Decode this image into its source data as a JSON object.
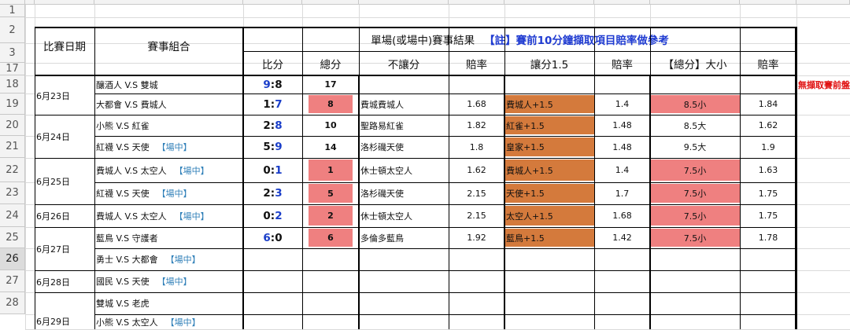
{
  "columns": [
    "A",
    "B",
    "C",
    "D",
    "E",
    "F",
    "G",
    "H",
    "I",
    "J",
    "K",
    "L"
  ],
  "row_numbers": [
    "1",
    "2",
    "3",
    "17",
    "18",
    "19",
    "20",
    "21",
    "22",
    "23",
    "24",
    "25",
    "26",
    "27",
    "28"
  ],
  "header": {
    "date": "比賽日期",
    "match": "賽事組合",
    "result_title": "單場(或場中)賽事結果",
    "note": "【註】賽前10分鐘擷取項目賠率做參考",
    "score": "比分",
    "total": "總分",
    "no_handicap": "不讓分",
    "odds1": "賠率",
    "handicap": "讓分1.5",
    "odds2": "賠率",
    "over_under": "【總分】大小",
    "odds3": "賠率"
  },
  "side_note": "無擷取賽前盤",
  "dates": [
    "6月23日",
    "6月24日",
    "6月25日",
    "6月26日",
    "6月27日",
    "6月28日",
    "6月29日"
  ],
  "rows": [
    {
      "match": "釀酒人 V.S 雙城",
      "tag": "",
      "home": "9",
      "away": "8",
      "total": "17",
      "no_handicap": "",
      "odds1": "",
      "handicap": "",
      "odds2": "",
      "ou": "",
      "odds3": ""
    },
    {
      "match": "大都會 V.S 費城人",
      "tag": "",
      "home": "1",
      "away": "7",
      "total": "8",
      "no_handicap": "費城費城人",
      "odds1": "1.68",
      "handicap": "費城人+1.5",
      "odds2": "1.4",
      "ou": "8.5小",
      "odds3": "1.84"
    },
    {
      "match": "小熊 V.S 紅雀",
      "tag": "",
      "home": "2",
      "away": "8",
      "total": "10",
      "no_handicap": "聖路易紅雀",
      "odds1": "1.82",
      "handicap": "紅雀+1.5",
      "odds2": "1.48",
      "ou": "8.5大",
      "odds3": "1.62"
    },
    {
      "match": "紅襪 V.S 天使",
      "tag": "【場中】",
      "home": "5",
      "away": "9",
      "total": "14",
      "no_handicap": "洛杉磯天使",
      "odds1": "1.8",
      "handicap": "皇家+1.5",
      "odds2": "1.48",
      "ou": "9.5大",
      "odds3": "1.9"
    },
    {
      "match": "費城人 V.S 太空人",
      "tag": "【場中】",
      "home": "0",
      "away": "1",
      "total": "1",
      "no_handicap": "休士頓太空人",
      "odds1": "1.62",
      "handicap": "費城人+1.5",
      "odds2": "1.4",
      "ou": "7.5小",
      "odds3": "1.63"
    },
    {
      "match": "紅襪 V.S 天使",
      "tag": "【場中】",
      "home": "2",
      "away": "3",
      "total": "5",
      "no_handicap": "洛杉磯天使",
      "odds1": "2.15",
      "handicap": "天使+1.5",
      "odds2": "1.7",
      "ou": "7.5小",
      "odds3": "1.75"
    },
    {
      "match": "費城人 V.S 太空人",
      "tag": "【場中】",
      "home": "0",
      "away": "2",
      "total": "2",
      "no_handicap": "休士頓太空人",
      "odds1": "2.15",
      "handicap": "太空人+1.5",
      "odds2": "1.68",
      "ou": "7.5小",
      "odds3": "1.75"
    },
    {
      "match": "藍鳥 V.S 守護者",
      "tag": "",
      "home": "6",
      "away": "0",
      "total": "6",
      "no_handicap": "多倫多藍鳥",
      "odds1": "1.92",
      "handicap": "藍鳥+1.5",
      "odds2": "1.42",
      "ou": "7.5小",
      "odds3": "1.78"
    },
    {
      "match": "勇士 V.S 大都會",
      "tag": "【場中】",
      "home": "",
      "away": "",
      "total": "",
      "no_handicap": "",
      "odds1": "",
      "handicap": "",
      "odds2": "",
      "ou": "",
      "odds3": ""
    },
    {
      "match": "國民 V.S 天使",
      "tag": "【場中】",
      "home": "",
      "away": "",
      "total": "",
      "no_handicap": "",
      "odds1": "",
      "handicap": "",
      "odds2": "",
      "ou": "",
      "odds3": ""
    },
    {
      "match": "雙城 V.S 老虎",
      "tag": "",
      "home": "",
      "away": "",
      "total": "",
      "no_handicap": "",
      "odds1": "",
      "handicap": "",
      "odds2": "",
      "ou": "",
      "odds3": ""
    },
    {
      "match": "小熊 V.S 太空人",
      "tag": "【場中】",
      "home": "",
      "away": "",
      "total": "",
      "no_handicap": "",
      "odds1": "",
      "handicap": "",
      "odds2": "",
      "ou": "",
      "odds3": ""
    }
  ],
  "colors": {
    "pink": "#ef8080",
    "orange": "#d47a3c",
    "score_blue": "#1a3ec9",
    "tag_blue": "#2f7fb8",
    "note_blue": "#1f3bd1",
    "red": "#e01010"
  }
}
